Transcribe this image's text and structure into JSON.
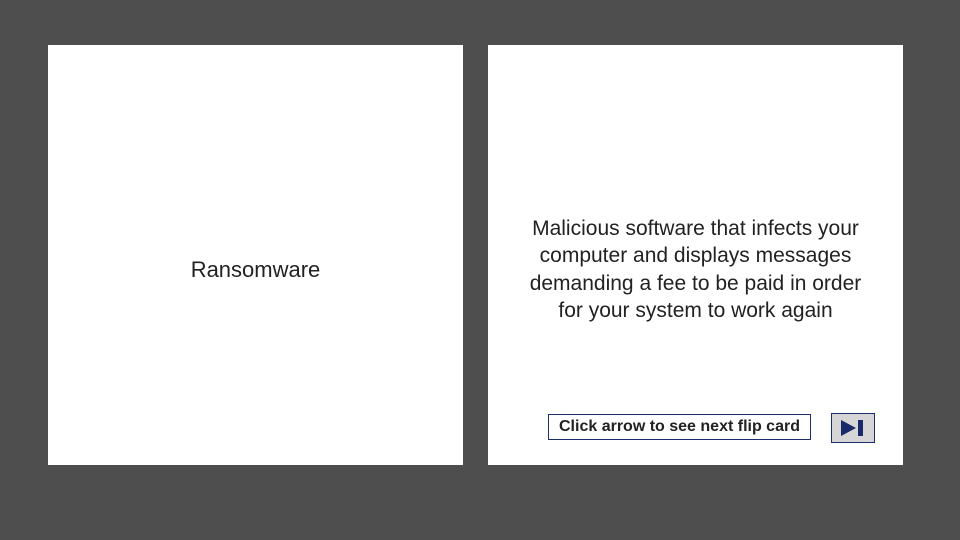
{
  "cards": {
    "left": {
      "term": "Ransomware"
    },
    "right": {
      "definition": "Malicious software that infects your computer and displays messages demanding a fee to be paid in order for your system to work again",
      "instruction": "Click arrow to see next flip card"
    }
  }
}
